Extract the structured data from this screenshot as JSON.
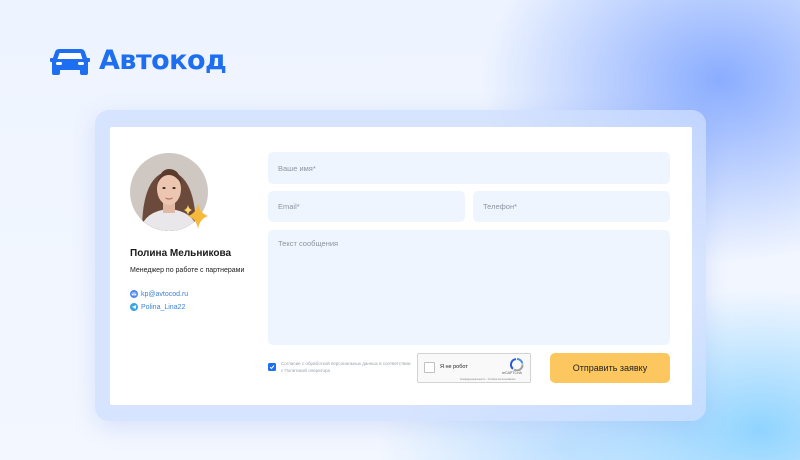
{
  "brand": {
    "name": "Автокод",
    "icon": "car-icon",
    "color": "#1d6ef0"
  },
  "manager": {
    "name": "Полина Мельникова",
    "role": "Менеджер по работе с партнерами",
    "email": "kp@avtocod.ru",
    "email_icon": "mail-icon",
    "telegram": "Polina_Lina22",
    "telegram_icon": "telegram-icon"
  },
  "form": {
    "name_placeholder": "Ваше имя*",
    "email_placeholder": "Email*",
    "phone_placeholder": "Телефон*",
    "message_placeholder": "Текст сообщения",
    "consent_checked": true,
    "consent_text": "Согласие с обработкой персональных данных в соответствии с Политикой оператора",
    "captcha": {
      "label": "Я не робот",
      "brand": "reCAPTCHA",
      "terms": "Конфиденциальность - Условия использования"
    },
    "submit_label": "Отправить заявку"
  },
  "colors": {
    "accent": "#1d6ef0",
    "button": "#fbc75e",
    "field_bg": "#eff5ff"
  }
}
